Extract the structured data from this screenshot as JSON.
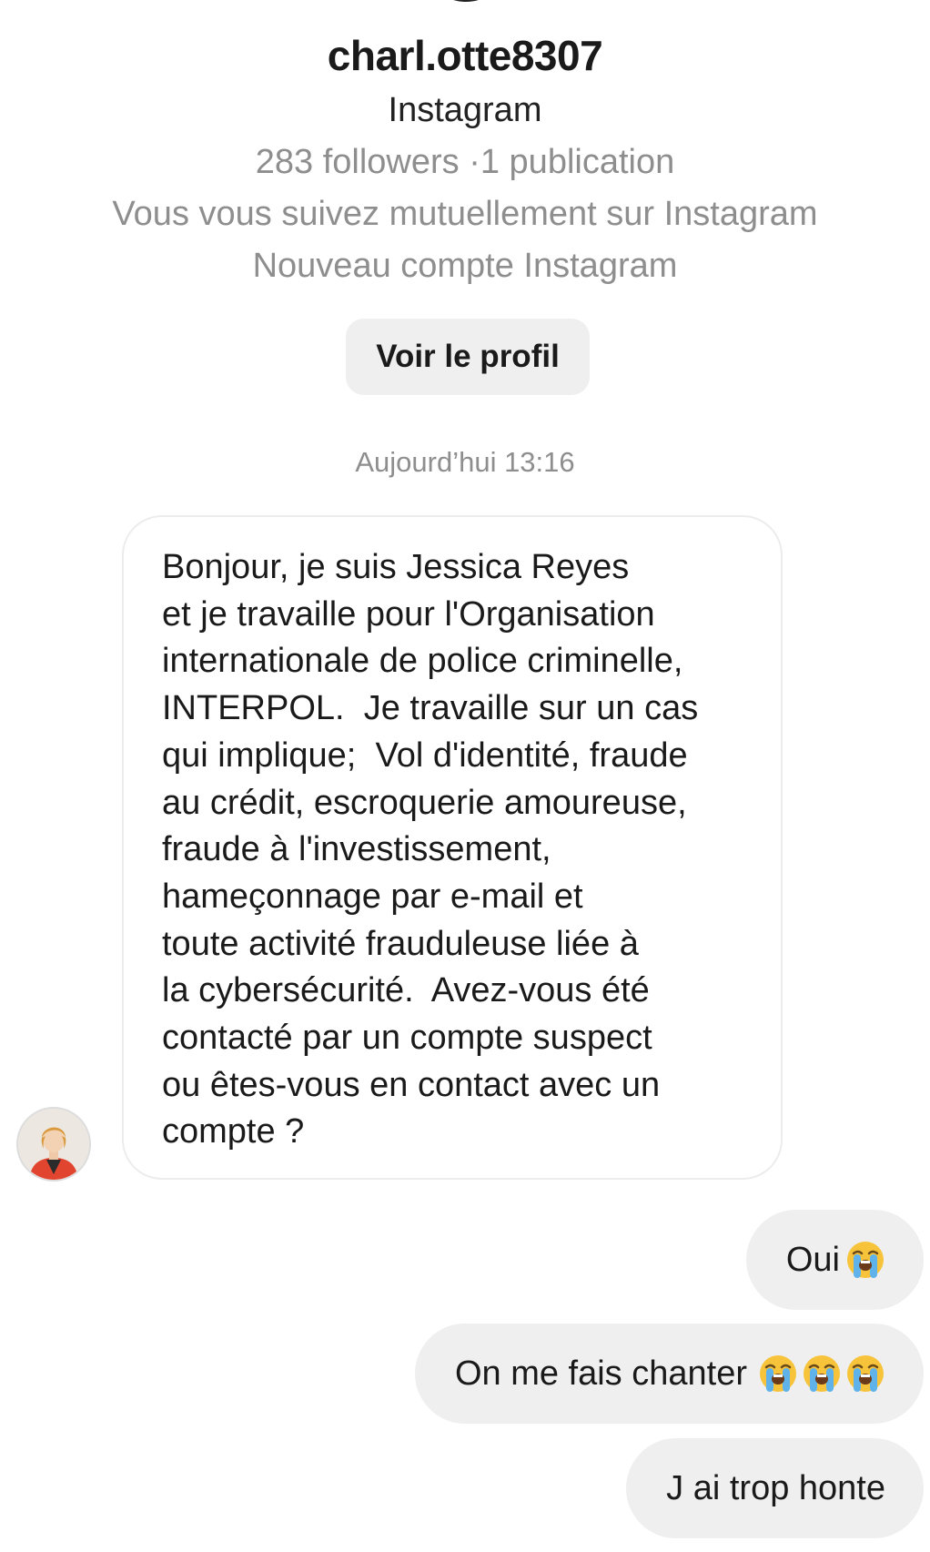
{
  "header": {
    "username": "charl.otte8307",
    "platform": "Instagram",
    "stats": "283 followers ·1 publication",
    "mutual": "Vous vous suivez mutuellement sur Instagram",
    "account_note": "Nouveau compte Instagram"
  },
  "profile_button_label": "Voir le profil",
  "timestamp": "Aujourd’hui 13:16",
  "messages": {
    "incoming": {
      "lines": [
        "Bonjour, je suis Jessica Reyes",
        "et je travaille pour l'Organisation",
        "internationale de police criminelle,",
        "INTERPOL.  Je travaille sur un cas",
        "qui implique;  Vol d'identité, fraude",
        "au crédit, escroquerie amoureuse,",
        "fraude à l'investissement,",
        "hameçonnage par e-mail et",
        "toute activité frauduleuse liée à",
        "la cybersécurité.  Avez-vous été",
        "contacté par un compte suspect",
        "ou êtes-vous en contact avec un",
        "compte ?"
      ]
    },
    "outgoing": [
      {
        "text": "Oui",
        "emoji_count": 1,
        "emoji": "loudly-crying-face"
      },
      {
        "text": "On me fais chanter",
        "emoji_count": 3,
        "emoji": "loudly-crying-face"
      },
      {
        "text": "J ai trop honte",
        "emoji_count": 0
      }
    ]
  },
  "colors": {
    "outgoing_bubble": "#efefef",
    "secondary_text": "#8e8e8e",
    "incoming_border": "#ececec"
  }
}
